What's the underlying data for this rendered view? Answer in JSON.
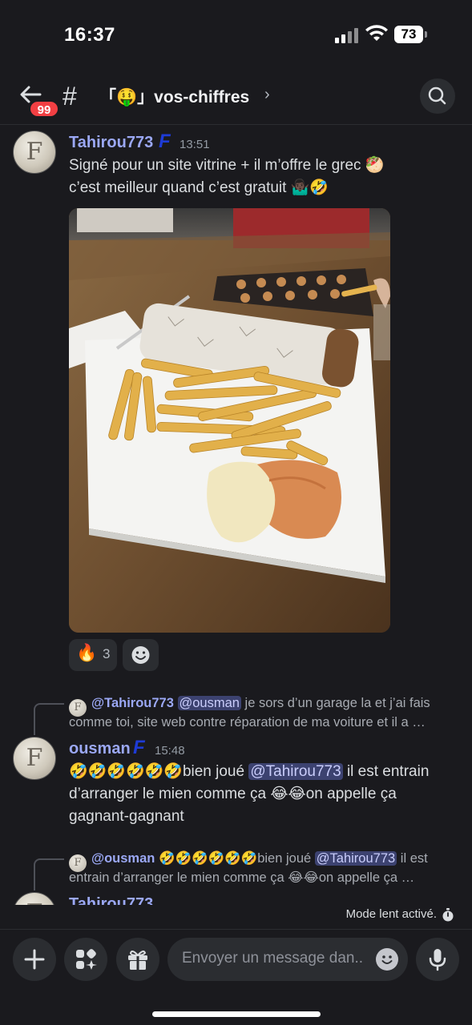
{
  "status_bar": {
    "time": "16:37",
    "battery": "73"
  },
  "header": {
    "unread_badge": "99",
    "hash_symbol": "#",
    "channel_name": "「🤑」vos-chiffres",
    "chevron": "›"
  },
  "messages": [
    {
      "author": "Tahirou773",
      "role_icon": "F",
      "timestamp": "13:51",
      "line1": "Signé pour un site vitrine + il m’offre le grec 🥙",
      "line2": "c’est meilleur quand c’est gratuit 🤷🏿‍♂️🤣",
      "reactions": [
        {
          "emoji": "🔥",
          "count": "3"
        }
      ]
    },
    {
      "reply_to": {
        "avatar_letter": "F",
        "author": "@Tahirou773",
        "mention": "@ousman",
        "text": "je sors d’un garage la et j’ai fais",
        "line2": "comme toi, site web contre réparation de ma voiture et il a …"
      },
      "author": "ousman",
      "role_icon": "F",
      "timestamp": "15:48",
      "part1": "🤣🤣🤣🤣🤣🤣bien joué ",
      "mention": "@Tahirou773",
      "part2": " il est entrain",
      "line2": "d’arranger le mien comme ça 😂😂on appelle ça",
      "line3": "gagnant-gagnant"
    },
    {
      "reply_to": {
        "avatar_letter": "F",
        "author": "@ousman",
        "text": " 🤣🤣🤣🤣🤣🤣bien joué ",
        "mention": "@Tahirou773",
        "text_after": " il est",
        "line2": "entrain d’arranger le mien comme ça 😂😂on appelle ça …"
      },
      "author_partial": "Tahirou773"
    }
  ],
  "slowmode": {
    "label": "Mode lent activé."
  },
  "composer": {
    "placeholder": "Envoyer un message dan.."
  },
  "colors": {
    "background": "#1a1a1e",
    "author": "#9ba8f5",
    "mention_bg": "#3c4270",
    "badge": "#f23f43"
  }
}
